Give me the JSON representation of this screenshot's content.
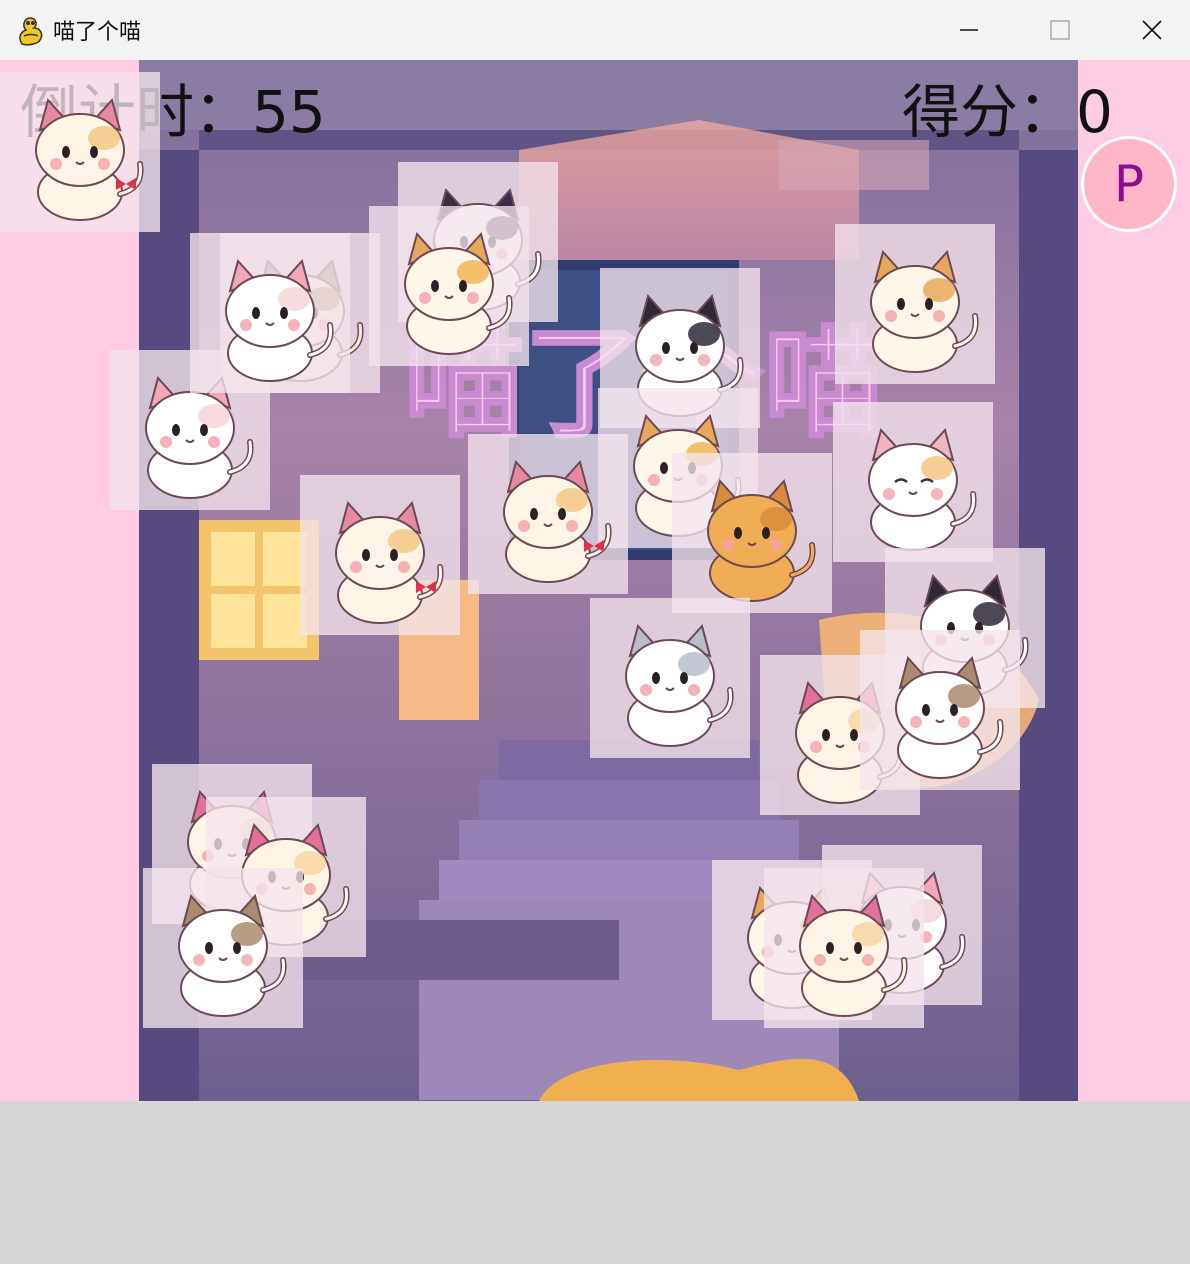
{
  "window": {
    "title": "喵了个喵",
    "icon": "pygame-snake-icon",
    "controls": [
      "minimize-icon",
      "maximize-icon",
      "close-icon"
    ]
  },
  "hud": {
    "countdown_label": "倒计时：",
    "countdown_value": "55",
    "score_label": "得分：",
    "score_value": "0"
  },
  "pause_button": {
    "label": "P"
  },
  "colors": {
    "side_background": "#ffcce4",
    "tile_background": "#f4e4ec",
    "pause_button": "#ffb6c8",
    "pause_text": "#8a0c92",
    "tray": "#d6d6d6"
  },
  "background_logo_text": "喵了个喵",
  "tiles": [
    {
      "type": "cream-cat-red-bow"
    },
    {
      "type": "white-cat-black-ears"
    },
    {
      "type": "tabby-brown-cat"
    },
    {
      "type": "black-white-cat"
    },
    {
      "type": "calico-orange-cat"
    },
    {
      "type": "white-cat"
    },
    {
      "type": "calico-sitting-cat"
    },
    {
      "type": "white-cat"
    },
    {
      "type": "cream-cat-red-bow"
    },
    {
      "type": "calico-sitting-cat"
    },
    {
      "type": "orange-cat"
    },
    {
      "type": "sleepy-white-cat"
    },
    {
      "type": "cream-cat-red-bow"
    },
    {
      "type": "black-white-cat"
    },
    {
      "type": "grey-white-cat"
    },
    {
      "type": "pink-ear-cream-cat"
    },
    {
      "type": "brown-white-cat"
    },
    {
      "type": "pink-ear-cream-cat"
    },
    {
      "type": "pink-ear-cream-cat"
    },
    {
      "type": "brown-white-cat"
    },
    {
      "type": "calico-orange-cat"
    },
    {
      "type": "white-cat-heart"
    },
    {
      "type": "pink-ear-cream-cat"
    }
  ]
}
